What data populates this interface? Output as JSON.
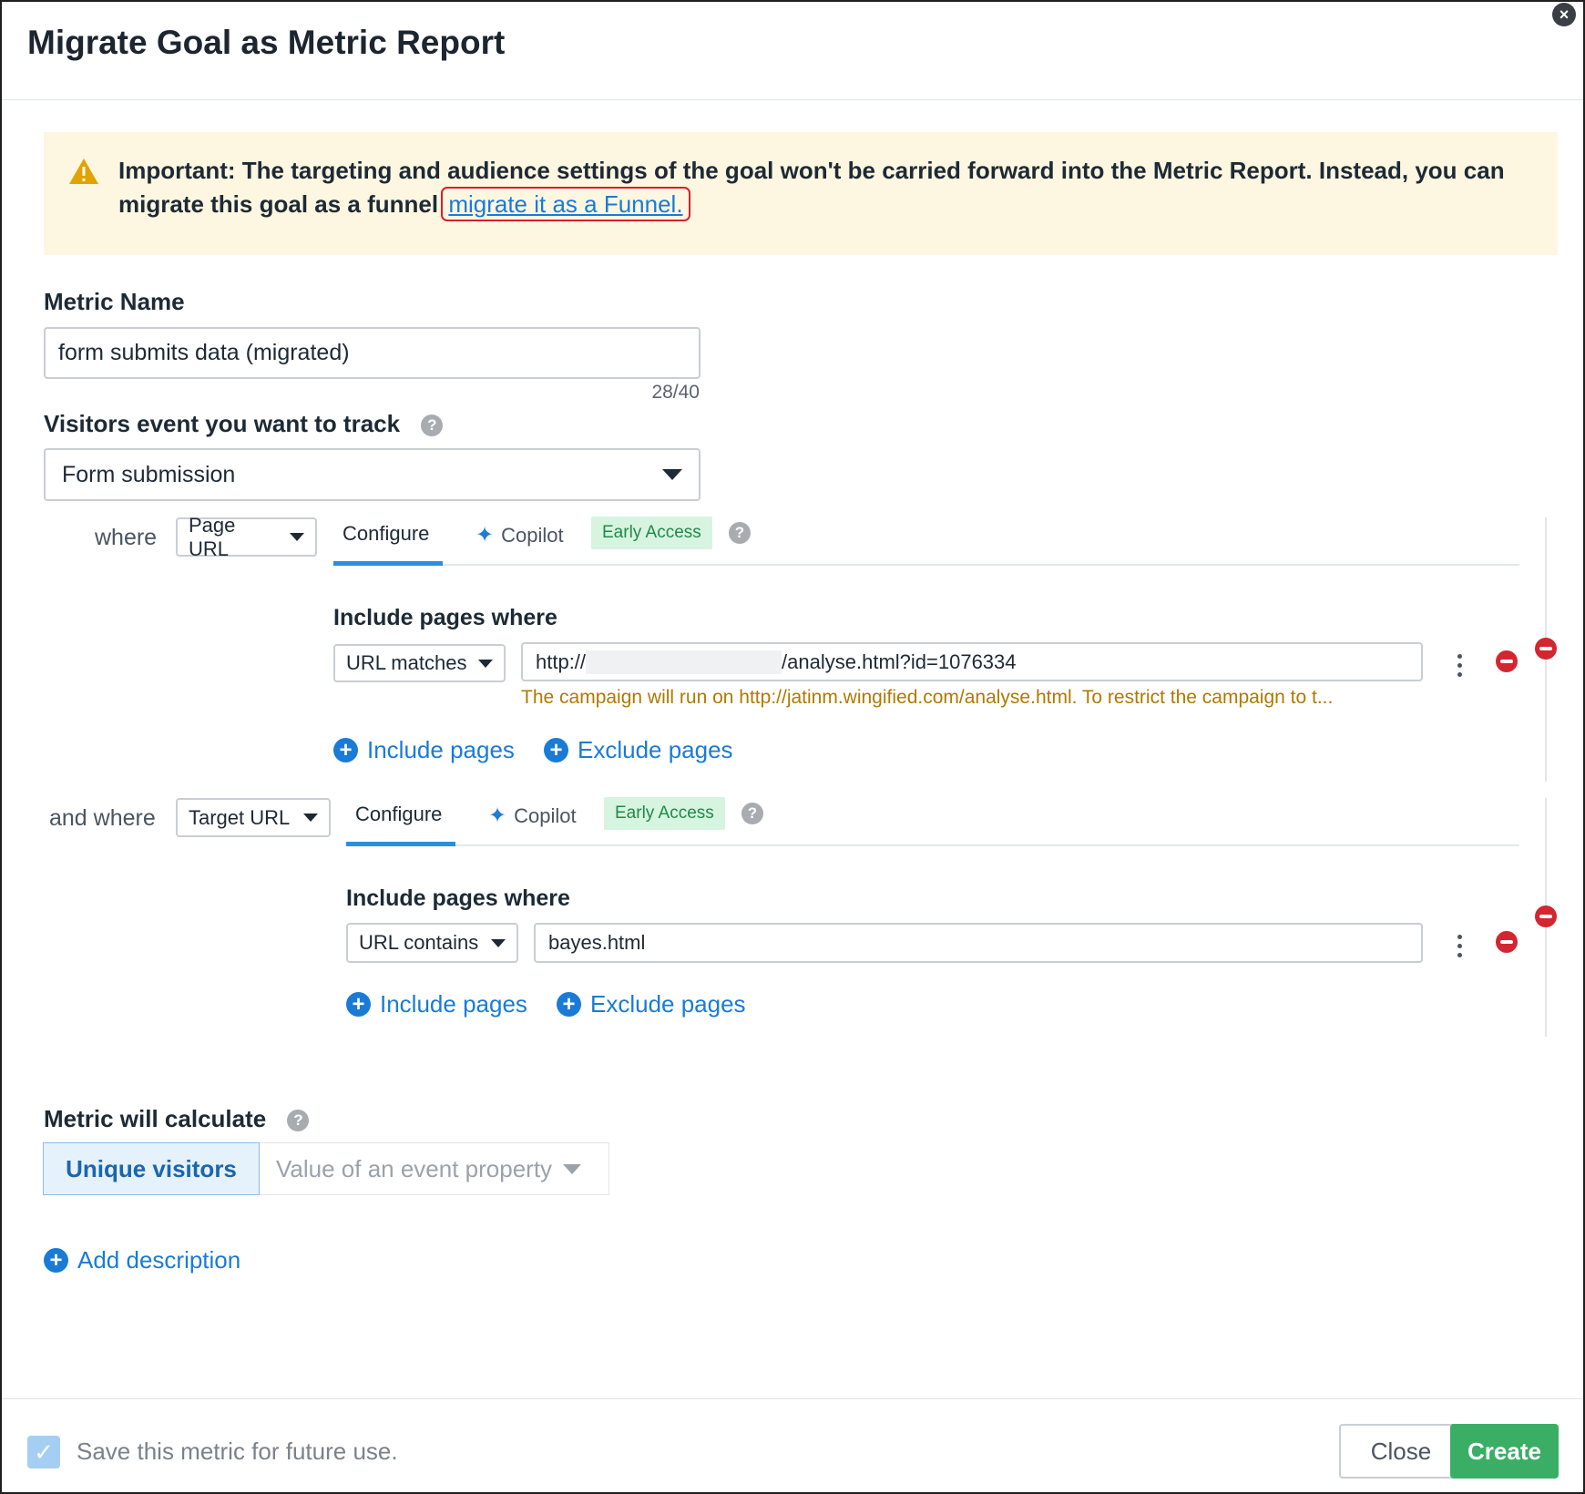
{
  "dialog": {
    "title": "Migrate Goal as Metric Report",
    "close_icon": "close-icon"
  },
  "banner": {
    "icon": "warning-icon",
    "text": "Important: The targeting and audience settings of the goal won't be carried forward into the Metric Report. Instead, you can migrate this goal as a funnel ",
    "link": "migrate it as a Funnel."
  },
  "metric_name": {
    "label": "Metric Name",
    "value": "form submits data (migrated)",
    "counter": "28/40"
  },
  "event": {
    "label": "Visitors event you want to track",
    "value": "Form submission"
  },
  "conditions": [
    {
      "connector": "where",
      "property": "Page URL",
      "tab_configure": "Configure",
      "tab_copilot": "Copilot",
      "badge": "Early Access",
      "include_label": "Include pages where",
      "match_type": "URL matches",
      "url_prefix": "http://",
      "url_suffix": "/analyse.html?id=1076334",
      "warning": "The campaign will run on http://jatinm.wingified.com/analyse.html. To restrict the campaign to t...",
      "include_link": "Include pages",
      "exclude_link": "Exclude pages"
    },
    {
      "connector": "and where",
      "property": "Target URL",
      "tab_configure": "Configure",
      "tab_copilot": "Copilot",
      "badge": "Early Access",
      "include_label": "Include pages where",
      "match_type": "URL contains",
      "url_value": "bayes.html",
      "include_link": "Include pages",
      "exclude_link": "Exclude pages"
    }
  ],
  "calculate": {
    "label": "Metric will calculate",
    "option_selected": "Unique visitors",
    "option_other": "Value of an event property"
  },
  "add_description": "Add description",
  "footer": {
    "save_label": "Save this metric for future use.",
    "close_label": "Close",
    "create_label": "Create"
  },
  "colors": {
    "primary_link": "#1a7bd6",
    "create_button": "#3aae65",
    "banner_bg": "#fdf6e1",
    "warning_text": "#b07900",
    "remove_icon": "#d32630"
  }
}
